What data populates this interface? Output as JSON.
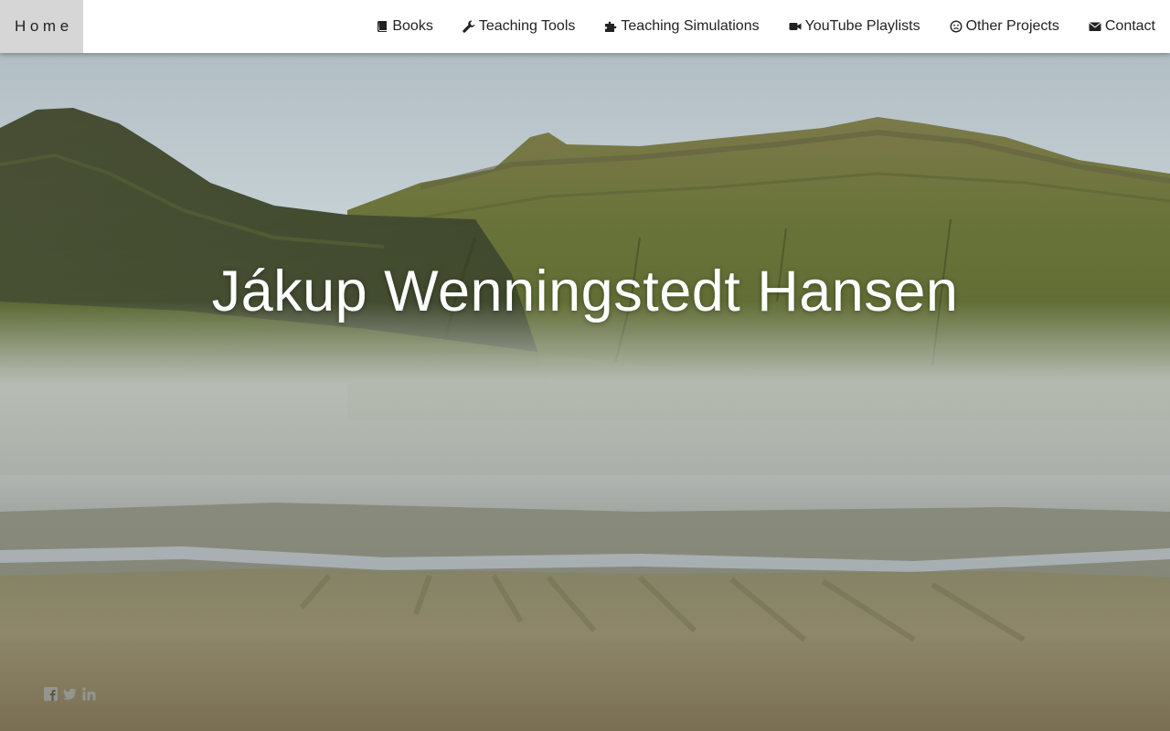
{
  "nav": {
    "home_label": "Home",
    "items": [
      {
        "label": "Books",
        "icon": "book-icon"
      },
      {
        "label": "Teaching Tools",
        "icon": "wrench-icon"
      },
      {
        "label": "Teaching Simulations",
        "icon": "puzzle-icon"
      },
      {
        "label": "YouTube Playlists",
        "icon": "video-camera-icon"
      },
      {
        "label": "Other Projects",
        "icon": "smiley-icon"
      },
      {
        "label": "Contact",
        "icon": "envelope-icon"
      }
    ]
  },
  "hero": {
    "title": "Jákup Wenningstedt Hansen",
    "background": "faroese-mountain-valley-with-fog"
  },
  "social": [
    "facebook-icon",
    "twitter-icon",
    "linkedin-icon"
  ],
  "colors": {
    "nav_bg": "#ffffff",
    "home_bg": "#d6d6d6",
    "title_text": "#ffffff"
  }
}
